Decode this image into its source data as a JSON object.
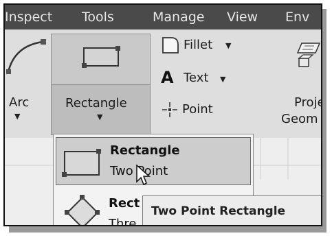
{
  "menubar": {
    "items": [
      "Inspect",
      "Tools",
      "Manage",
      "View",
      "Env"
    ]
  },
  "ribbon": {
    "arc_label": "Arc",
    "rectangle_label": "Rectangle",
    "fillet_label": "Fillet",
    "text_label": "Text",
    "point_label": "Point",
    "project_geometry_label_1": "Proje",
    "project_geometry_label_2": "Geom"
  },
  "dropdown": {
    "items": [
      {
        "title": "Rectangle",
        "subtitle": "Two Point",
        "icon": "rectangle-two-point-icon"
      },
      {
        "title": "Rect",
        "subtitle": "Thre",
        "icon": "rectangle-three-point-icon"
      }
    ]
  },
  "tooltip": {
    "text": "Two Point Rectangle"
  },
  "colors": {
    "menubar_bg": "#4a4a4a",
    "ribbon_bg": "#dedede",
    "highlight": "#cdcdcd"
  }
}
